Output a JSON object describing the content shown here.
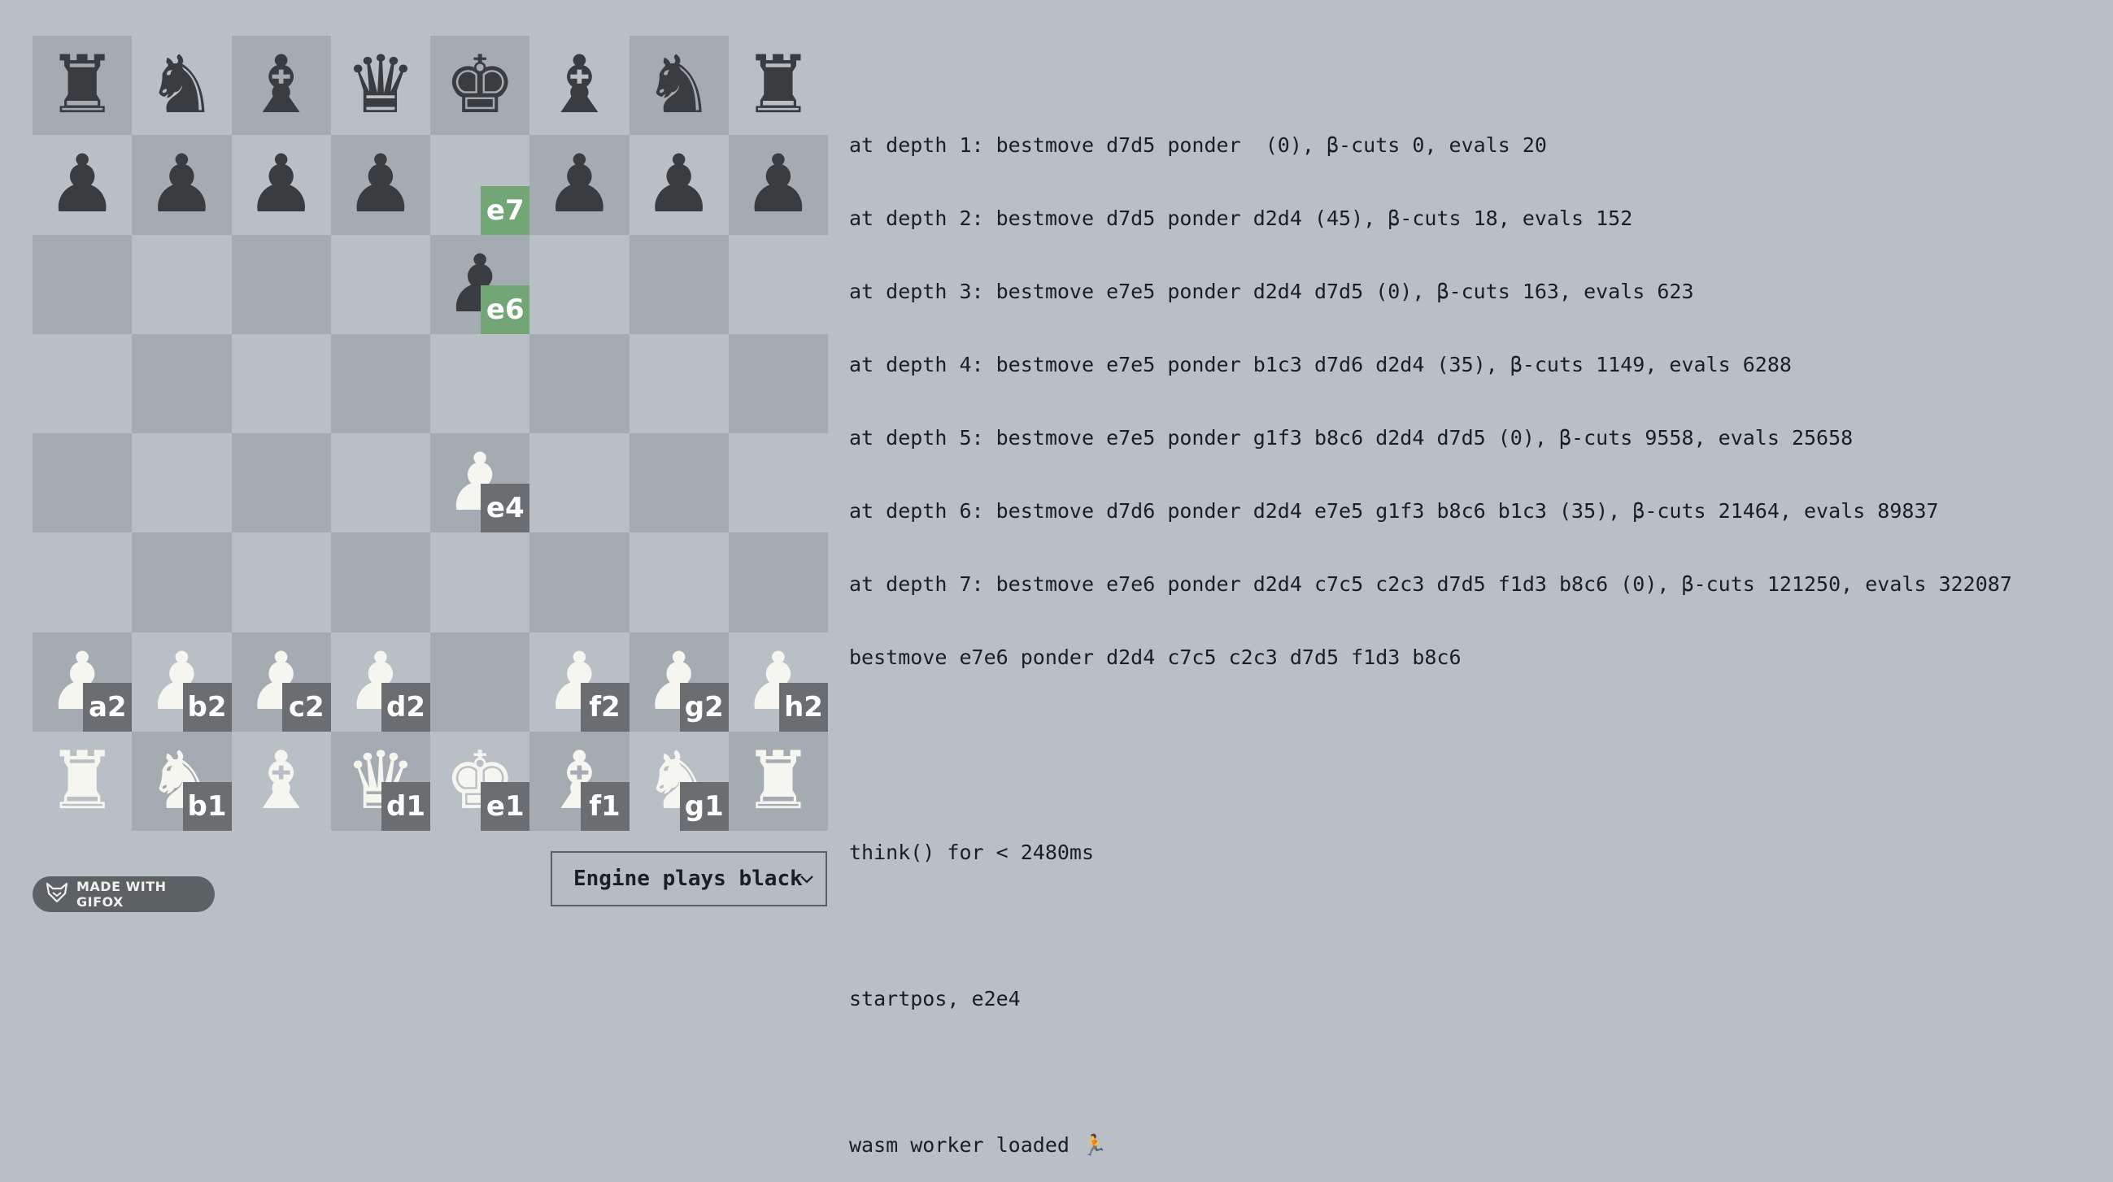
{
  "board": {
    "orientation": "white-bottom",
    "pieces": {
      "a8": {
        "color": "black",
        "type": "rook"
      },
      "b8": {
        "color": "black",
        "type": "knight"
      },
      "c8": {
        "color": "black",
        "type": "bishop"
      },
      "d8": {
        "color": "black",
        "type": "queen"
      },
      "e8": {
        "color": "black",
        "type": "king"
      },
      "f8": {
        "color": "black",
        "type": "bishop"
      },
      "g8": {
        "color": "black",
        "type": "knight"
      },
      "h8": {
        "color": "black",
        "type": "rook"
      },
      "a7": {
        "color": "black",
        "type": "pawn"
      },
      "b7": {
        "color": "black",
        "type": "pawn"
      },
      "c7": {
        "color": "black",
        "type": "pawn"
      },
      "d7": {
        "color": "black",
        "type": "pawn"
      },
      "f7": {
        "color": "black",
        "type": "pawn"
      },
      "g7": {
        "color": "black",
        "type": "pawn"
      },
      "h7": {
        "color": "black",
        "type": "pawn"
      },
      "e6": {
        "color": "black",
        "type": "pawn"
      },
      "e4": {
        "color": "white",
        "type": "pawn"
      },
      "a2": {
        "color": "white",
        "type": "pawn"
      },
      "b2": {
        "color": "white",
        "type": "pawn"
      },
      "c2": {
        "color": "white",
        "type": "pawn"
      },
      "d2": {
        "color": "white",
        "type": "pawn"
      },
      "f2": {
        "color": "white",
        "type": "pawn"
      },
      "g2": {
        "color": "white",
        "type": "pawn"
      },
      "h2": {
        "color": "white",
        "type": "pawn"
      },
      "a1": {
        "color": "white",
        "type": "rook"
      },
      "b1": {
        "color": "white",
        "type": "knight"
      },
      "c1": {
        "color": "white",
        "type": "bishop"
      },
      "d1": {
        "color": "white",
        "type": "queen"
      },
      "e1": {
        "color": "white",
        "type": "king"
      },
      "f1": {
        "color": "white",
        "type": "bishop"
      },
      "g1": {
        "color": "white",
        "type": "knight"
      },
      "h1": {
        "color": "white",
        "type": "rook"
      }
    },
    "square_labels": [
      {
        "square": "e7",
        "text": "e7",
        "highlight": true
      },
      {
        "square": "e6",
        "text": "e6",
        "highlight": true
      },
      {
        "square": "e4",
        "text": "e4",
        "highlight": false
      },
      {
        "square": "a2",
        "text": "a2",
        "highlight": false
      },
      {
        "square": "b2",
        "text": "b2",
        "highlight": false
      },
      {
        "square": "c2",
        "text": "c2",
        "highlight": false
      },
      {
        "square": "d2",
        "text": "d2",
        "highlight": false
      },
      {
        "square": "f2",
        "text": "f2",
        "highlight": false
      },
      {
        "square": "g2",
        "text": "g2",
        "highlight": false
      },
      {
        "square": "h2",
        "text": "h2",
        "highlight": false
      },
      {
        "square": "b1",
        "text": "b1",
        "highlight": false
      },
      {
        "square": "d1",
        "text": "d1",
        "highlight": false
      },
      {
        "square": "e1",
        "text": "e1",
        "highlight": false
      },
      {
        "square": "f1",
        "text": "f1",
        "highlight": false
      },
      {
        "square": "g1",
        "text": "g1",
        "highlight": false
      }
    ],
    "colors": {
      "light_square": "#b8c0c5",
      "dark_square": "#a4abb1",
      "label_bg": "#6b6e70",
      "highlight_bg": "#72a677",
      "black_piece": "#3a3d40",
      "white_piece": "#f6f6f1"
    }
  },
  "log": {
    "lines": [
      "at depth 1: bestmove d7d5 ponder  (0), β-cuts 0, evals 20",
      "at depth 2: bestmove d7d5 ponder d2d4 (45), β-cuts 18, evals 152",
      "at depth 3: bestmove e7e5 ponder d2d4 d7d5 (0), β-cuts 163, evals 623",
      "at depth 4: bestmove e7e5 ponder b1c3 d7d6 d2d4 (35), β-cuts 1149, evals 6288",
      "at depth 5: bestmove e7e5 ponder g1f3 b8c6 d2d4 d7d5 (0), β-cuts 9558, evals 25658",
      "at depth 6: bestmove d7d6 ponder d2d4 e7e5 g1f3 b8c6 b1c3 (35), β-cuts 21464, evals 89837",
      "at depth 7: bestmove e7e6 ponder d2d4 c7c5 c2c3 d7d5 f1d3 b8c6 (0), β-cuts 121250, evals 322087",
      "bestmove e7e6 ponder d2d4 c7c5 c2c3 d7d5 f1d3 b8c6"
    ],
    "think_line": "think() for < 2480ms",
    "position_line": "startpos, e2e4",
    "worker_line": "wasm worker loaded 🏃"
  },
  "engine_select": {
    "selected": "Engine plays black",
    "icon": "chevron-down-icon"
  },
  "badge": {
    "label": "MADE WITH GIFOX",
    "icon": "fox-icon"
  }
}
